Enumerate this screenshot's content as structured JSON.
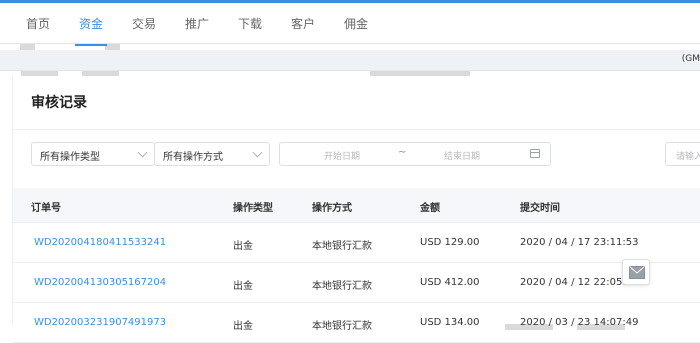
{
  "nav": {
    "items": [
      {
        "label": "首页"
      },
      {
        "label": "资金"
      },
      {
        "label": "交易"
      },
      {
        "label": "推广"
      },
      {
        "label": "下载"
      },
      {
        "label": "客户"
      },
      {
        "label": "佣金"
      }
    ],
    "active_index": 1
  },
  "timezone_bar": {
    "text": "(GM"
  },
  "card": {
    "title": "审核记录"
  },
  "filters": {
    "operation_type": "所有操作类型",
    "operation_method": "所有操作方式",
    "start_date_placeholder": "开始日期",
    "date_separator": "~",
    "end_date_placeholder": "结束日期",
    "search_placeholder": "请输入"
  },
  "table": {
    "headers": [
      "订单号",
      "操作类型",
      "操作方式",
      "金额",
      "提交时间"
    ],
    "rows": [
      {
        "order": "WD202004180411533241",
        "type": "出金",
        "method": "本地银行汇款",
        "amount": "USD 129.00",
        "time": "2020 / 04 / 17 23:11:53"
      },
      {
        "order": "WD202004130305167204",
        "type": "出金",
        "method": "本地银行汇款",
        "amount": "USD 412.00",
        "time": "2020 / 04 / 12 22:05:16"
      },
      {
        "order": "WD202003231907491973",
        "type": "出金",
        "method": "本地银行汇款",
        "amount": "USD 134.00",
        "time": "2020 / 03 / 23 14:07:49"
      }
    ]
  },
  "colors": {
    "accent": "#3a8ee6",
    "header_bg": "#f5f7fa"
  },
  "icons": {
    "mail": "mail-icon",
    "calendar": "calendar-icon",
    "chevron": "chevron-down-icon"
  }
}
